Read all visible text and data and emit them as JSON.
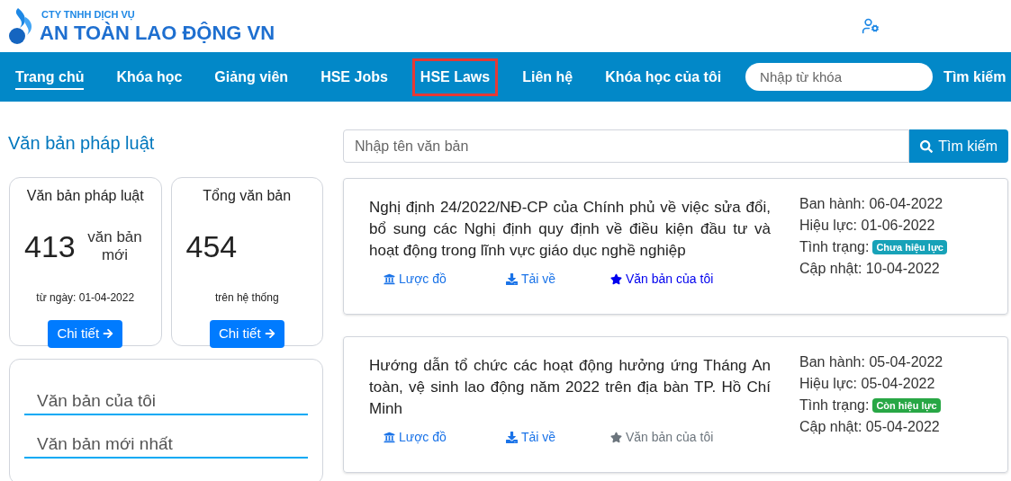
{
  "logo": {
    "tagline": "CTY TNHH DỊCH VỤ",
    "name": "AN TOÀN LAO ĐỘNG VN"
  },
  "nav": {
    "items": [
      {
        "label": "Trang chủ",
        "selected": true,
        "outlined": false
      },
      {
        "label": "Khóa học",
        "selected": false,
        "outlined": false
      },
      {
        "label": "Giảng viên",
        "selected": false,
        "outlined": false
      },
      {
        "label": "HSE Jobs",
        "selected": false,
        "outlined": false
      },
      {
        "label": "HSE Laws",
        "selected": false,
        "outlined": true
      },
      {
        "label": "Liên hệ",
        "selected": false,
        "outlined": false
      },
      {
        "label": "Khóa học của tôi",
        "selected": false,
        "outlined": false
      }
    ],
    "search": {
      "placeholder": "Nhập từ khóa",
      "button": "Tìm kiếm"
    }
  },
  "sidebar": {
    "title": "Văn bản pháp luật",
    "stats": [
      {
        "title": "Văn bản pháp luật",
        "count": "413",
        "unit": "văn bản mới",
        "note": "từ ngày: 01-04-2022",
        "button": "Chi tiết"
      },
      {
        "title": "Tổng văn bản",
        "count": "454",
        "note": "trên hệ thống",
        "button": "Chi tiết"
      }
    ],
    "links": [
      "Văn bản của tôi",
      "Văn bản mới nhất"
    ]
  },
  "search": {
    "placeholder": "Nhập tên văn bản",
    "button": "Tìm kiếm"
  },
  "documents": [
    {
      "title": "Nghị định 24/2022/NĐ-CP của Chính phủ về việc sửa đổi, bổ sung các Nghị định quy định về điều kiện đầu tư và hoạt động trong lĩnh vực giáo dục nghề nghiệp",
      "actions": [
        "Lược đồ",
        "Tải về",
        "Văn bản của tôi"
      ],
      "saved": true,
      "issued": "Ban hành: 06-04-2022",
      "effective": "Hiệu lực: 01-06-2022",
      "status_label": "Tình trạng:",
      "status": "Chưa hiệu lực",
      "color": "#17a2b8",
      "updated": "Cập nhật: 10-04-2022"
    },
    {
      "title": "Hướng dẫn tổ chức các hoạt động hưởng ứng Tháng An toàn, vệ sinh lao động năm 2022 trên địa bàn TP. Hồ Chí Minh",
      "actions": [
        "Lược đồ",
        "Tải về",
        "Văn bản của tôi"
      ],
      "saved": false,
      "issued": "Ban hành: 05-04-2022",
      "effective": "Hiệu lực: 05-04-2022",
      "status_label": "Tình trạng:",
      "status": "Còn hiệu lực",
      "color": "#28a745",
      "updated": "Cập nhật: 05-04-2022"
    }
  ]
}
